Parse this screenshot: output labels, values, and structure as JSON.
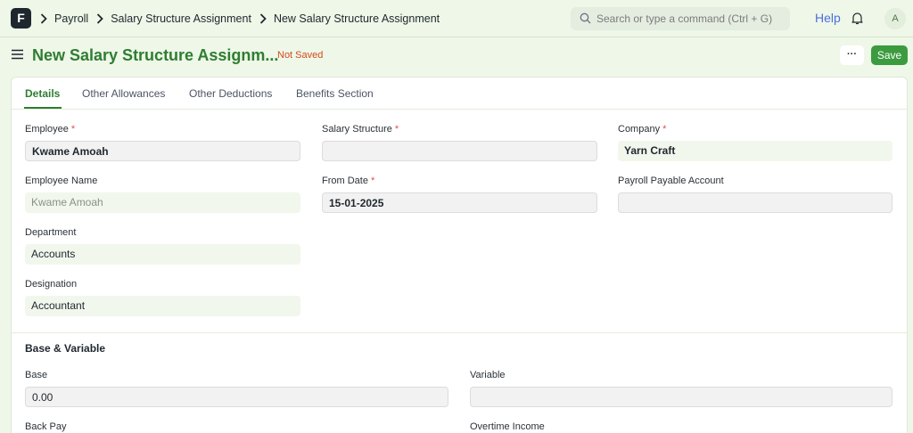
{
  "navbar": {
    "logo_letter": "F",
    "breadcrumbs": [
      "Payroll",
      "Salary Structure Assignment",
      "New Salary Structure Assignment"
    ],
    "search_placeholder": "Search or type a command (Ctrl + G)",
    "help_label": "Help",
    "avatar_initial": "A"
  },
  "page": {
    "title": "New Salary Structure Assignm...",
    "status": "Not Saved",
    "menu_label": "···",
    "save_label": "Save"
  },
  "tabs": [
    "Details",
    "Other Allowances",
    "Other Deductions",
    "Benefits Section"
  ],
  "fields": {
    "employee": {
      "label": "Employee",
      "value": "Kwame Amoah"
    },
    "employee_name": {
      "label": "Employee Name",
      "value": "Kwame Amoah"
    },
    "department": {
      "label": "Department",
      "value": "Accounts"
    },
    "designation": {
      "label": "Designation",
      "value": "Accountant"
    },
    "salary_structure": {
      "label": "Salary Structure",
      "value": ""
    },
    "from_date": {
      "label": "From Date",
      "value": "15-01-2025"
    },
    "company": {
      "label": "Company",
      "value": "Yarn Craft"
    },
    "payroll_payable_account": {
      "label": "Payroll Payable Account",
      "value": ""
    }
  },
  "base_variable": {
    "title": "Base & Variable",
    "base": {
      "label": "Base",
      "value": "0.00"
    },
    "variable": {
      "label": "Variable",
      "value": ""
    },
    "back_pay": {
      "label": "Back Pay"
    },
    "overtime_income": {
      "label": "Overtime Income"
    }
  },
  "required_mark": "*",
  "colors": {
    "brand": "#2f7d32",
    "primary_button": "#3d9b3f",
    "not_saved": "#d44a1f",
    "help_link": "#4c6fdf"
  }
}
